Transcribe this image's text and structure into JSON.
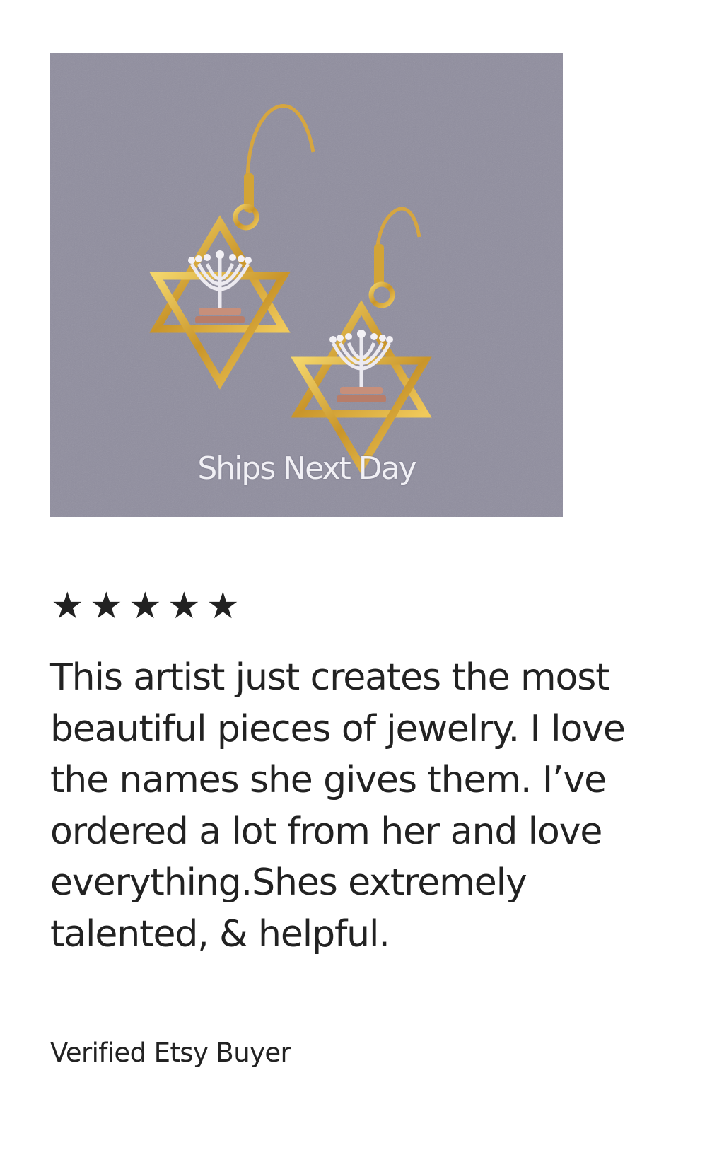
{
  "product_image": {
    "overlay_text": "Ships Next Day"
  },
  "review": {
    "stars": [
      "★",
      "★",
      "★",
      "★",
      "★"
    ],
    "rating": 5,
    "rating_max": 5,
    "text": "This artist just creates the most beautiful pieces of jewelry. I love the names she gives them. I’ve ordered a lot from her and love everything.Shes extremely talented, & helpful.",
    "reviewer": "Verified Etsy Buyer"
  },
  "colors": {
    "background": "#ffffff",
    "text": "#222222",
    "photo_background": "#8f8d9e",
    "gold": "#d9a82e",
    "silver": "#e8e6ea"
  }
}
